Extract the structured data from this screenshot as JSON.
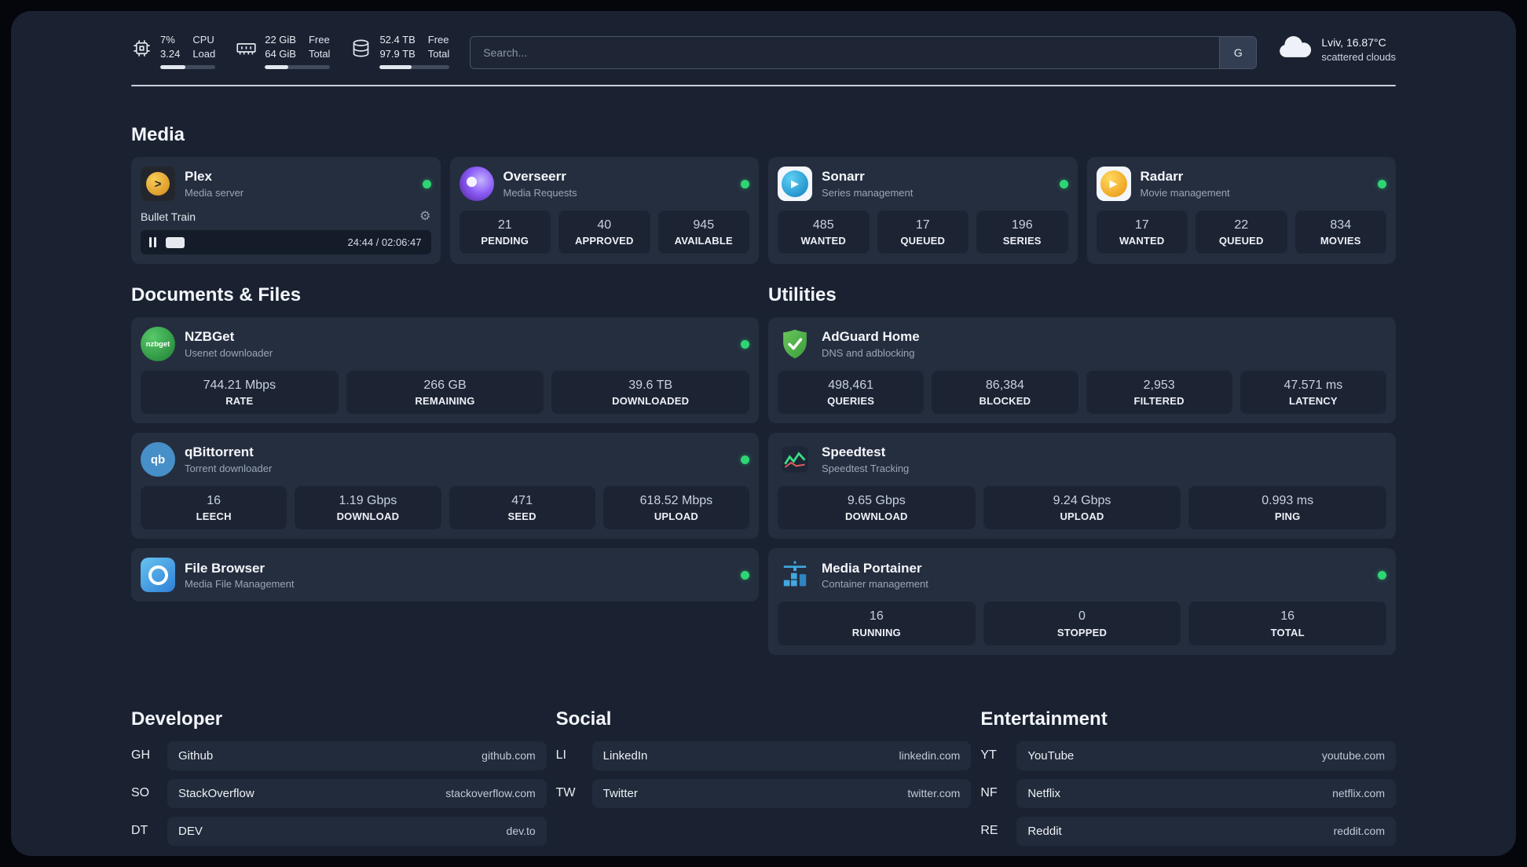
{
  "colors": {
    "status_online": "#2ed573",
    "background": "#1a2231",
    "card": "#252e3f",
    "tile": "#1c2434"
  },
  "icons": {
    "cpu": "chip-icon",
    "ram": "memory-icon",
    "disk": "storage-icon",
    "weather": "cloud-icon",
    "search_engine": "G",
    "player_pause": "pause-icon",
    "player_settings": "gear-icon"
  },
  "topbar": {
    "cpu": {
      "line1": "7%",
      "line2": "3.24",
      "label1": "CPU",
      "label2": "Load"
    },
    "ram": {
      "line1": "22 GiB",
      "line2": "64 GiB",
      "label1": "Free",
      "label2": "Total"
    },
    "disk": {
      "line1": "52.4 TB",
      "line2": "97.9 TB",
      "label1": "Free",
      "label2": "Total"
    },
    "search": {
      "placeholder": "Search...",
      "engine_button": "G"
    },
    "weather": {
      "location": "Lviv, 16.87°C",
      "condition": "scattered clouds"
    }
  },
  "sections": {
    "media": {
      "title": "Media",
      "plex": {
        "name": "Plex",
        "subtitle": "Media server",
        "now_playing": {
          "title": "Bullet Train",
          "time": "24:44 / 02:06:47"
        }
      },
      "overseerr": {
        "name": "Overseerr",
        "subtitle": "Media Requests",
        "stats": [
          {
            "value": "21",
            "label": "PENDING"
          },
          {
            "value": "40",
            "label": "APPROVED"
          },
          {
            "value": "945",
            "label": "AVAILABLE"
          }
        ]
      },
      "sonarr": {
        "name": "Sonarr",
        "subtitle": "Series management",
        "stats": [
          {
            "value": "485",
            "label": "WANTED"
          },
          {
            "value": "17",
            "label": "QUEUED"
          },
          {
            "value": "196",
            "label": "SERIES"
          }
        ]
      },
      "radarr": {
        "name": "Radarr",
        "subtitle": "Movie management",
        "stats": [
          {
            "value": "17",
            "label": "WANTED"
          },
          {
            "value": "22",
            "label": "QUEUED"
          },
          {
            "value": "834",
            "label": "MOVIES"
          }
        ]
      }
    },
    "documents": {
      "title": "Documents & Files",
      "nzbget": {
        "name": "NZBGet",
        "subtitle": "Usenet downloader",
        "icon_text": "nzbget",
        "stats": [
          {
            "value": "744.21 Mbps",
            "label": "RATE"
          },
          {
            "value": "266 GB",
            "label": "REMAINING"
          },
          {
            "value": "39.6 TB",
            "label": "DOWNLOADED"
          }
        ]
      },
      "qbittorrent": {
        "name": "qBittorrent",
        "subtitle": "Torrent downloader",
        "icon_text": "qb",
        "stats": [
          {
            "value": "16",
            "label": "LEECH"
          },
          {
            "value": "1.19 Gbps",
            "label": "DOWNLOAD"
          },
          {
            "value": "471",
            "label": "SEED"
          },
          {
            "value": "618.52 Mbps",
            "label": "UPLOAD"
          }
        ]
      },
      "filebrowser": {
        "name": "File Browser",
        "subtitle": "Media File Management"
      }
    },
    "utilities": {
      "title": "Utilities",
      "adguard": {
        "name": "AdGuard Home",
        "subtitle": "DNS and adblocking",
        "stats": [
          {
            "value": "498,461",
            "label": "QUERIES"
          },
          {
            "value": "86,384",
            "label": "BLOCKED"
          },
          {
            "value": "2,953",
            "label": "FILTERED"
          },
          {
            "value": "47.571 ms",
            "label": "LATENCY"
          }
        ]
      },
      "speedtest": {
        "name": "Speedtest",
        "subtitle": "Speedtest Tracking",
        "stats": [
          {
            "value": "9.65 Gbps",
            "label": "DOWNLOAD"
          },
          {
            "value": "9.24 Gbps",
            "label": "UPLOAD"
          },
          {
            "value": "0.993 ms",
            "label": "PING"
          }
        ]
      },
      "portainer": {
        "name": "Media Portainer",
        "subtitle": "Container management",
        "stats": [
          {
            "value": "16",
            "label": "RUNNING"
          },
          {
            "value": "0",
            "label": "STOPPED"
          },
          {
            "value": "16",
            "label": "TOTAL"
          }
        ]
      }
    }
  },
  "bookmarks": [
    {
      "title": "Developer",
      "items": [
        {
          "abbr": "GH",
          "name": "Github",
          "url": "github.com"
        },
        {
          "abbr": "SO",
          "name": "StackOverflow",
          "url": "stackoverflow.com"
        },
        {
          "abbr": "DT",
          "name": "DEV",
          "url": "dev.to"
        }
      ]
    },
    {
      "title": "Social",
      "items": [
        {
          "abbr": "LI",
          "name": "LinkedIn",
          "url": "linkedin.com"
        },
        {
          "abbr": "TW",
          "name": "Twitter",
          "url": "twitter.com"
        }
      ]
    },
    {
      "title": "Entertainment",
      "items": [
        {
          "abbr": "YT",
          "name": "YouTube",
          "url": "youtube.com"
        },
        {
          "abbr": "NF",
          "name": "Netflix",
          "url": "netflix.com"
        },
        {
          "abbr": "RE",
          "name": "Reddit",
          "url": "reddit.com"
        }
      ]
    }
  ]
}
